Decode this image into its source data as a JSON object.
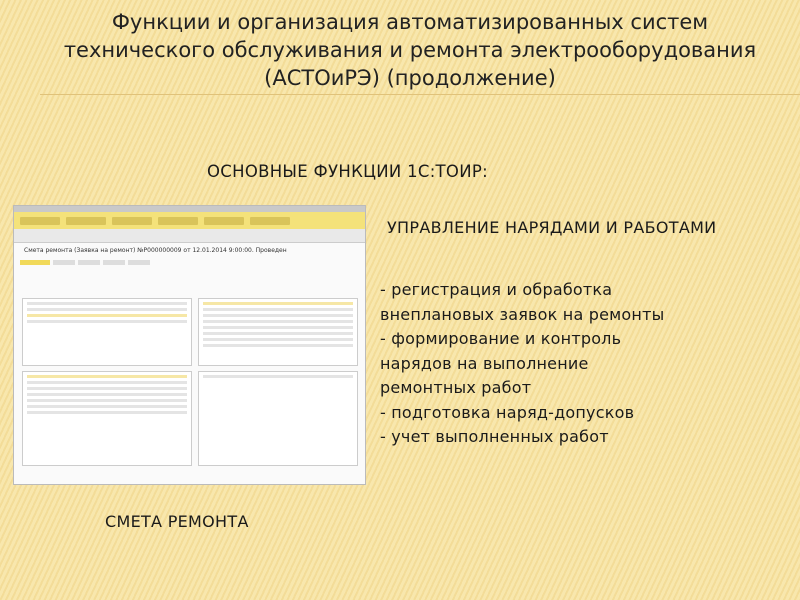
{
  "title": [
    "Функции и организация автоматизированных систем",
    "технического обслуживания и ремонта электрооборудования",
    "(АСТОиРЭ) (продолжение)"
  ],
  "subheading": "ОСНОВНЫЕ ФУНКЦИИ 1С:ТОИР:",
  "section_heading": "УПРАВЛЕНИЕ НАРЯДАМИ И РАБОТАМИ",
  "bullets": [
    "- регистрация и обработка",
    "внеплановых заявок на ремонты",
    "- формирование и контроль",
    "нарядов на выполнение",
    "ремонтных работ",
    "- подготовка наряд-допусков",
    "- учет выполненных работ"
  ],
  "screenshot": {
    "document_title": "Смета ремонта (Заявка на ремонт) №Р000000009 от 12.01.2014 9:00:00. Проведен"
  },
  "caption": "СМЕТА РЕМОНТА"
}
